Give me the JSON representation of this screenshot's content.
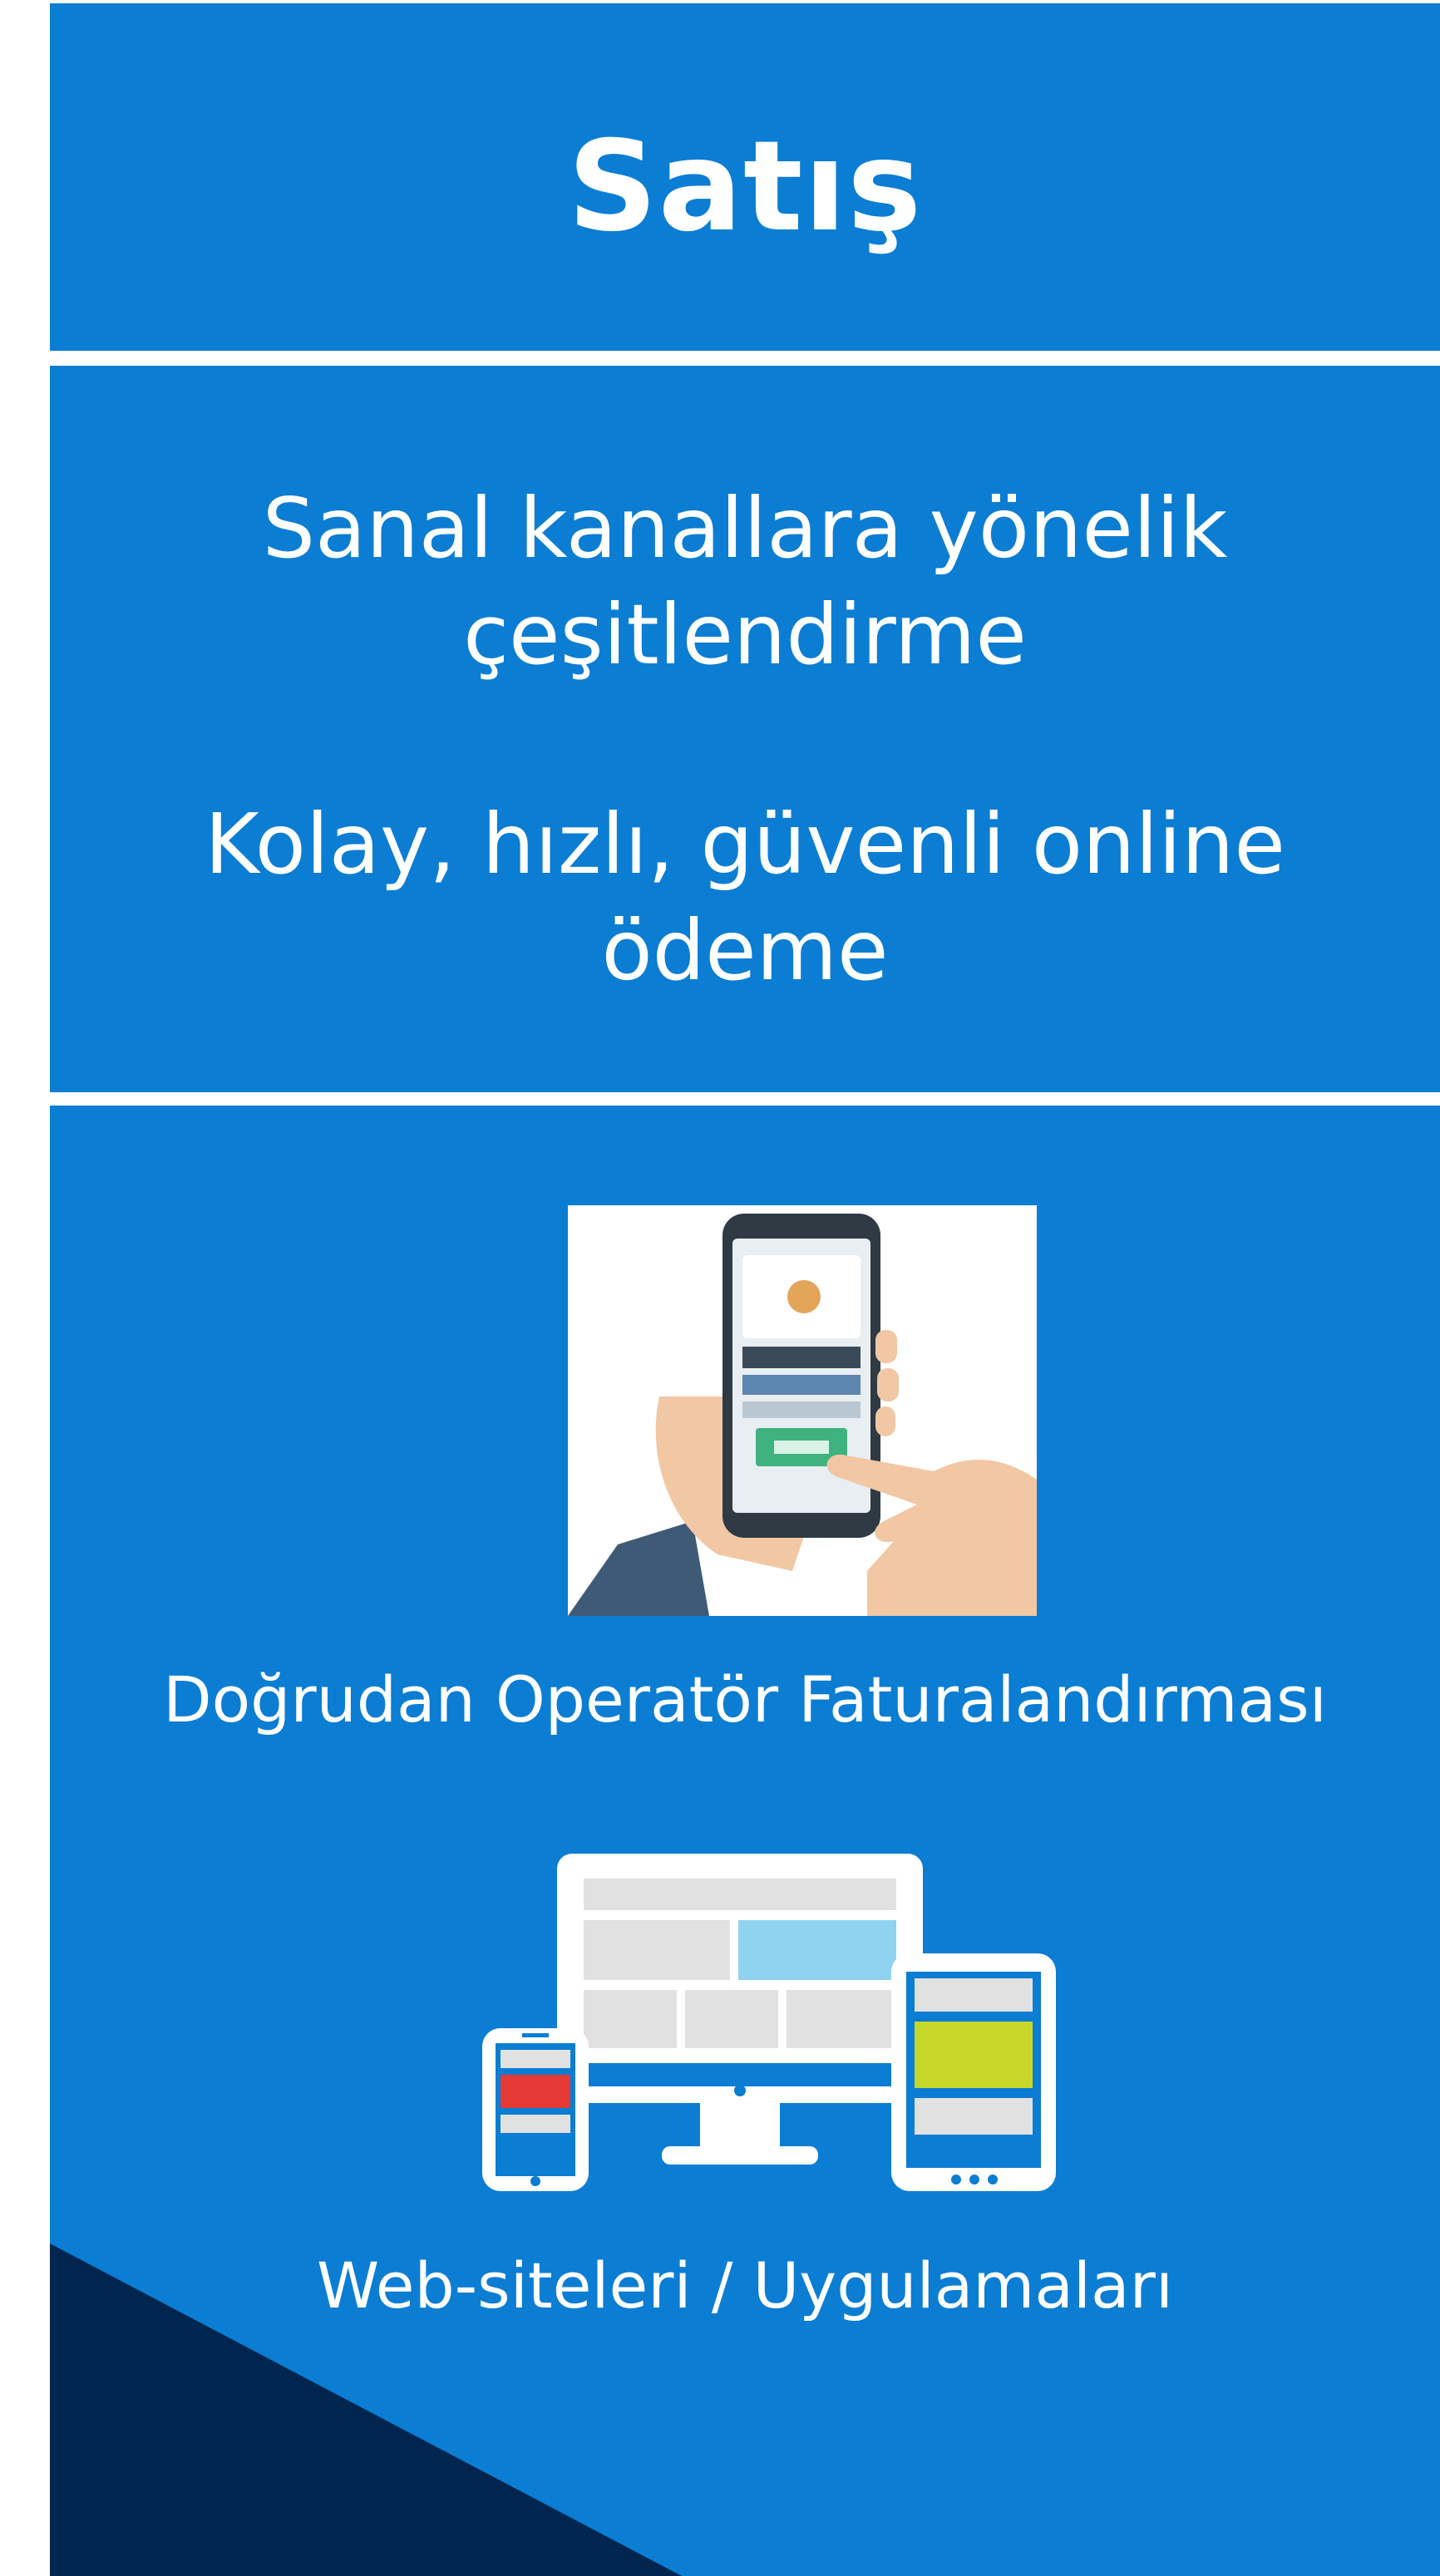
{
  "title": "Satış",
  "text_blocks": [
    {
      "lines": [
        "Sanal kanallara yönelik",
        "çeşitlendirme"
      ]
    },
    {
      "lines": [
        "Kolay, hızlı, güvenli online",
        "ödeme"
      ]
    }
  ],
  "features": [
    {
      "icon": "hand-holding-phone-icon",
      "label": "Doğrudan Operatör Faturalandırması"
    },
    {
      "icon": "responsive-devices-icon",
      "label": "Web-siteleri / Uygulamaları"
    }
  ],
  "colors": {
    "panel_blue": "#0b7dd3",
    "dark_navy": "#00264f",
    "text": "#ffffff"
  }
}
